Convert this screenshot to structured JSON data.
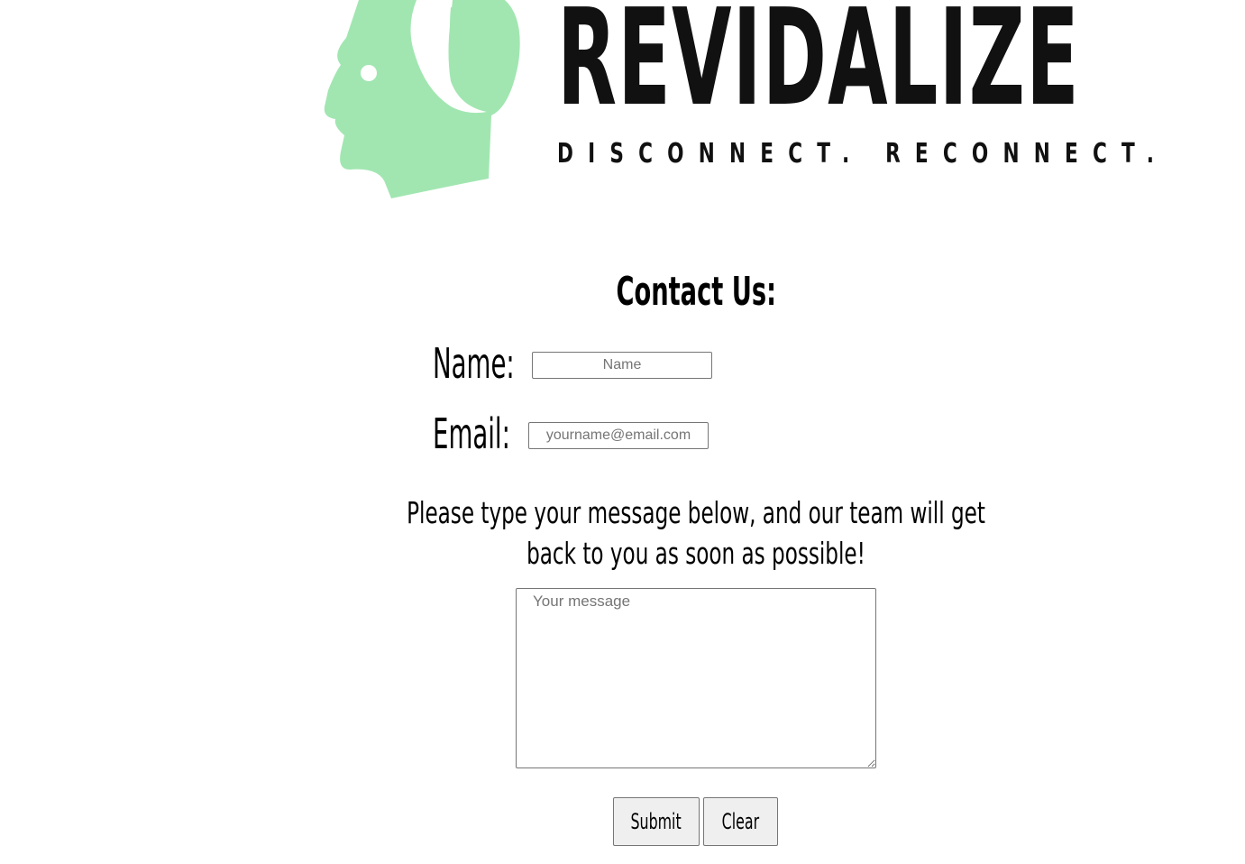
{
  "logo": {
    "brand": "REVIDALIZE",
    "tagline": "DISCONNECT. RECONNECT.",
    "icon": "head-leaf-icon",
    "icon_color": "#a1e6b1",
    "text_color": "#111111"
  },
  "contact": {
    "heading": "Contact Us:",
    "name_label": "Name:",
    "name_placeholder": "Name",
    "email_label": "Email:",
    "email_placeholder": "yourname@email.com",
    "message_prompt": "Please type your message below, and our team will get back to you as soon as possible!",
    "message_placeholder": "Your message",
    "submit_label": "Submit",
    "clear_label": "Clear"
  }
}
